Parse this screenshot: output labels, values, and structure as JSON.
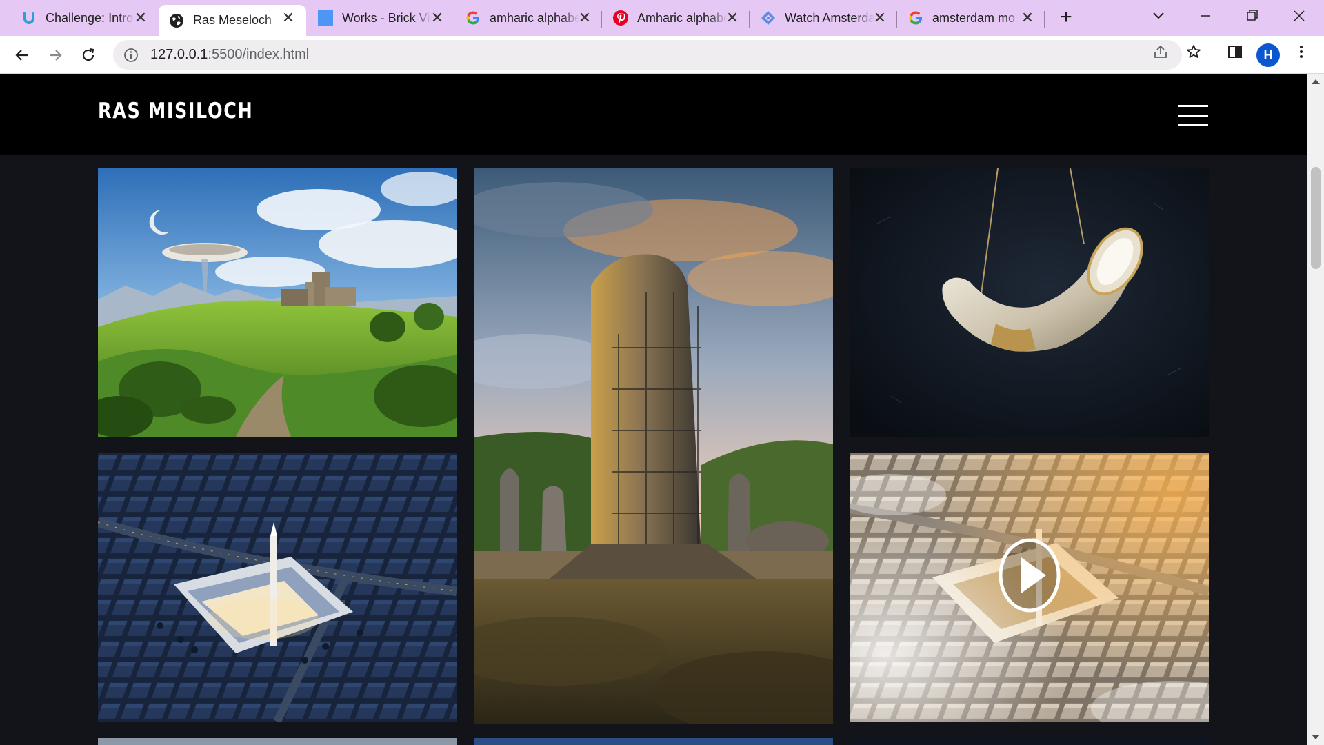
{
  "browser": {
    "tabs": [
      {
        "title": "Challenge: Intro",
        "icon": "udacity-icon",
        "active": false
      },
      {
        "title": "Ras Meseloch",
        "icon": "globe-icon",
        "active": true
      },
      {
        "title": "Works - Brick Visual",
        "icon": "page-icon",
        "active": false
      },
      {
        "title": "amharic alphabet",
        "icon": "google-icon",
        "active": false
      },
      {
        "title": "Amharic alphabet",
        "icon": "pinterest-icon",
        "active": false
      },
      {
        "title": "Watch Amsterdam",
        "icon": "streaming-icon",
        "active": false
      },
      {
        "title": "amsterdam mo",
        "icon": "google-icon",
        "active": false
      }
    ],
    "url_host": "127.0.0.1",
    "url_path": ":5500/index.html",
    "profile_initial": "H"
  },
  "site": {
    "logo": "RAS MISILOCH",
    "menu_icon": "hamburger-menu-icon"
  },
  "gallery": [
    {
      "name": "gallery-tile-castle-landscape",
      "subject": "castle on green hill with floating ring"
    },
    {
      "name": "gallery-tile-stone-obelisk",
      "subject": "carved stone stele under scaffolding at sunset"
    },
    {
      "name": "gallery-tile-ivory-horn",
      "subject": "suspended ivory horn on dark background"
    },
    {
      "name": "gallery-tile-mosque-night",
      "subject": "aerial night view of mosque in city"
    },
    {
      "name": "gallery-tile-mosque-video",
      "subject": "aerial day view of mosque in city with play button",
      "has_video": true
    }
  ]
}
